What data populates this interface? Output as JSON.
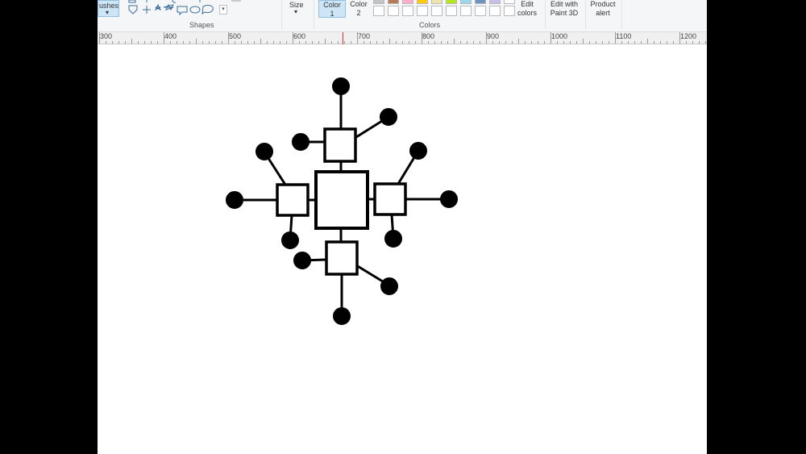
{
  "ribbon": {
    "brushes_label": "ushes",
    "brushes_arrow": "▾",
    "shapes_label": "Shapes",
    "size_label": "Size",
    "size_arrow": "▾",
    "color1_line1": "Color",
    "color1_line2": "1",
    "color2_line1": "Color",
    "color2_line2": "2",
    "colors_label": "Colors",
    "edit_colors_line1": "Edit",
    "edit_colors_line2": "colors",
    "paint3d_line1": "Edit with",
    "paint3d_line2": "Paint 3D",
    "product_alert_line1": "Product",
    "product_alert_line2": "alert",
    "shapes_more_arrow": "▾",
    "palette_top_colors": [
      "#c3c3c3",
      "#b97a57",
      "#ffaec9",
      "#ffc90e",
      "#efe4b0",
      "#b5e61d",
      "#99d9ea",
      "#7092be",
      "#c8bfe7"
    ]
  },
  "ruler": {
    "labels": [
      "300",
      "400",
      "500",
      "600",
      "700",
      "800",
      "900",
      "1000",
      "1100",
      "1200"
    ],
    "cursor_color": "#e0302e"
  },
  "drawing": {
    "stroke_color": "#000000",
    "fill_color": "#ffffff"
  }
}
